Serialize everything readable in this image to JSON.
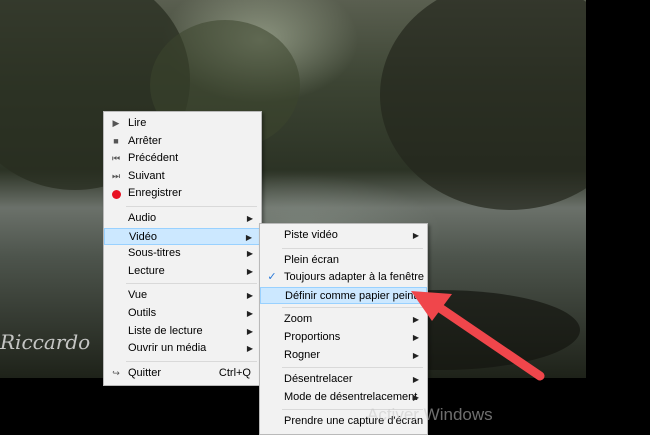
{
  "main_menu": {
    "items": [
      {
        "icon": "play-icon",
        "label": "Lire"
      },
      {
        "icon": "stop-icon",
        "label": "Arrêter"
      },
      {
        "icon": "previous-icon",
        "label": "Précédent"
      },
      {
        "icon": "next-icon",
        "label": "Suivant"
      },
      {
        "icon": "record-icon",
        "label": "Enregistrer"
      }
    ],
    "submenus": [
      "Audio",
      "Vidéo",
      "Sous-titres",
      "Lecture"
    ],
    "tools": [
      "Vue",
      "Outils",
      "Liste de lecture",
      "Ouvrir un média"
    ],
    "quit": {
      "label": "Quitter",
      "shortcut": "Ctrl+Q"
    }
  },
  "video_menu": {
    "track": "Piste vidéo",
    "fullscreen": "Plein écran",
    "fit_window": "Toujours adapter à la fenêtre",
    "wallpaper": "Définir comme papier peint",
    "zoom": "Zoom",
    "aspect": "Proportions",
    "crop": "Rogner",
    "deinterlace": "Désentrelacer",
    "deinterlace_mode": "Mode de désentrelacement",
    "snapshot": "Prendre une capture d'écran"
  },
  "video_signature": "Riccardo",
  "watermark": "Activer Windows",
  "colors": {
    "highlight": "#cce8ff",
    "highlight_border": "#99d1ff",
    "arrow": "#f0464b",
    "record": "#e81123"
  }
}
